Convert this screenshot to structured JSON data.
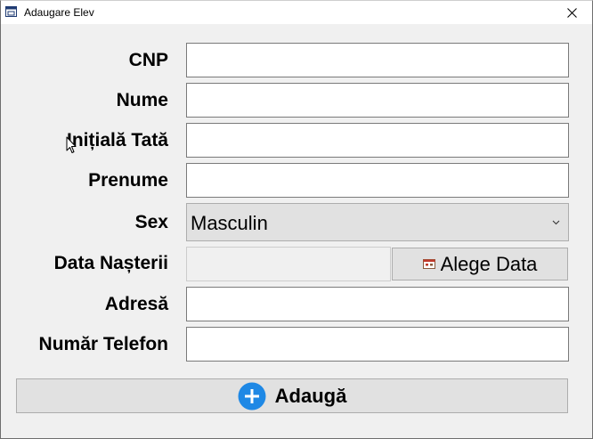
{
  "window": {
    "title": "Adaugare Elev",
    "icon": "window-app-icon",
    "close_icon": "close-icon"
  },
  "form": {
    "fields": [
      {
        "label": "CNP",
        "value": ""
      },
      {
        "label": "Nume",
        "value": ""
      },
      {
        "label": "Inițială Tată",
        "value": ""
      },
      {
        "label": "Prenume",
        "value": ""
      }
    ],
    "sex": {
      "label": "Sex",
      "selected": "Masculin"
    },
    "birth_date": {
      "label": "Data Nașterii",
      "value": "",
      "button_label": "Alege Data",
      "button_icon": "calendar-icon"
    },
    "address": {
      "label": "Adresă",
      "value": ""
    },
    "phone": {
      "label": "Număr Telefon",
      "value": ""
    }
  },
  "submit": {
    "label": "Adaugă",
    "icon": "plus-circle-icon",
    "icon_color": "#1e88e5"
  },
  "colors": {
    "background": "#f0f0f0",
    "accent": "#1e88e5"
  }
}
